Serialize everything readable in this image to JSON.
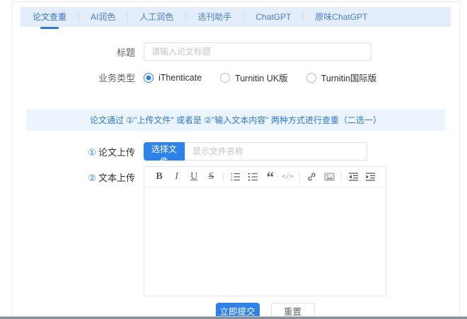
{
  "tabs": {
    "items": [
      {
        "label": "论文查重",
        "active": true
      },
      {
        "label": "AI润色",
        "active": false
      },
      {
        "label": "人工润色",
        "active": false
      },
      {
        "label": "选刊助手",
        "active": false
      },
      {
        "label": "ChatGPT",
        "active": false
      },
      {
        "label": "原味ChatGPT",
        "active": false
      }
    ]
  },
  "form": {
    "title": {
      "label": "标题",
      "value": "",
      "placeholder": "请输入论文标题"
    },
    "business_type": {
      "label": "业务类型",
      "options": [
        {
          "label": "iThenticate",
          "selected": true
        },
        {
          "label": "Turnitin UK版",
          "selected": false
        },
        {
          "label": "Turnitin国际版",
          "selected": false
        }
      ]
    },
    "notice": "论文通过 ①\"上传文件\" 或者是 ②\"输入文本内容\" 两种方式进行查重（二选一）",
    "upload": {
      "number": "①",
      "label": "论文上传",
      "button": "选择文件",
      "placeholder": "显示文件名称",
      "value": ""
    },
    "text_upload": {
      "number": "②",
      "label": "文本上传",
      "content": ""
    },
    "editor": {
      "toolbar_icons": [
        "bold-icon",
        "italic-icon",
        "underline-icon",
        "strikethrough-icon",
        "ordered-list-icon",
        "unordered-list-icon",
        "blockquote-icon",
        "code-icon",
        "link-icon",
        "image-icon",
        "indent-decrease-icon",
        "indent-increase-icon"
      ],
      "glyphs": {
        "bold": "B",
        "italic": "I",
        "underline": "U",
        "strikethrough": "S",
        "quote": "“",
        "code": "</>"
      }
    },
    "actions": {
      "submit": "立即提交",
      "reset": "重置"
    }
  },
  "colors": {
    "accent_blue": "#2e82e9",
    "tab_bar_bg": "#e4eefb",
    "tab_text": "#4a7dd4",
    "banner_bg": "#ecf4fd",
    "banner_text": "#2f7ad9",
    "input_border": "#dcdfe6",
    "placeholder": "#c0c4cc"
  }
}
